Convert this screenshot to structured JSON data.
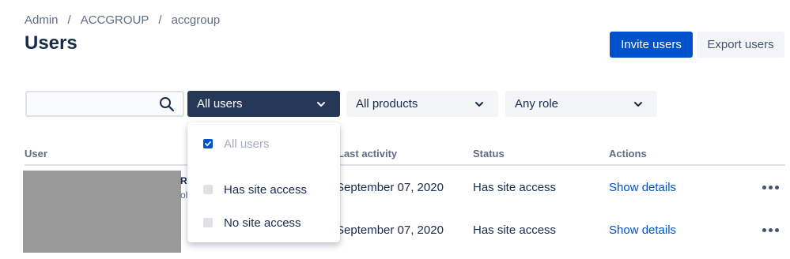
{
  "breadcrumb": {
    "items": [
      "Admin",
      "ACCGROUP",
      "accgroup"
    ],
    "separator": "/"
  },
  "page": {
    "title": "Users"
  },
  "actions": {
    "invite": "Invite users",
    "export": "Export users"
  },
  "filters": {
    "search": {
      "value": "",
      "placeholder": ""
    },
    "user_filter": "All users",
    "product_filter": "All products",
    "role_filter": "Any role"
  },
  "dropdown": {
    "options": [
      {
        "label": "All users",
        "checked": true,
        "disabled": true
      },
      {
        "label": "Has site access",
        "checked": false,
        "disabled": false
      },
      {
        "label": "No site access",
        "checked": false,
        "disabled": false
      }
    ]
  },
  "table": {
    "columns": [
      "User",
      "Last activity",
      "Status",
      "Actions"
    ],
    "rows": [
      {
        "name_fragment": "RC",
        "sub_fragment": "oh",
        "last_activity": "September 07, 2020",
        "status": "Has site access",
        "action": "Show details"
      },
      {
        "name_fragment": "",
        "sub_fragment": "",
        "last_activity": "September 07, 2020",
        "status": "Has site access",
        "action": "Show details"
      }
    ]
  },
  "colors": {
    "primary": "#0052CC",
    "dark_select": "#253858",
    "text": "#172B4D",
    "subtle": "#5E6C84"
  },
  "icons": {
    "search": "search-icon",
    "chevron": "chevron-down-icon",
    "more": "more-horizontal-icon",
    "check": "checkmark-icon"
  }
}
